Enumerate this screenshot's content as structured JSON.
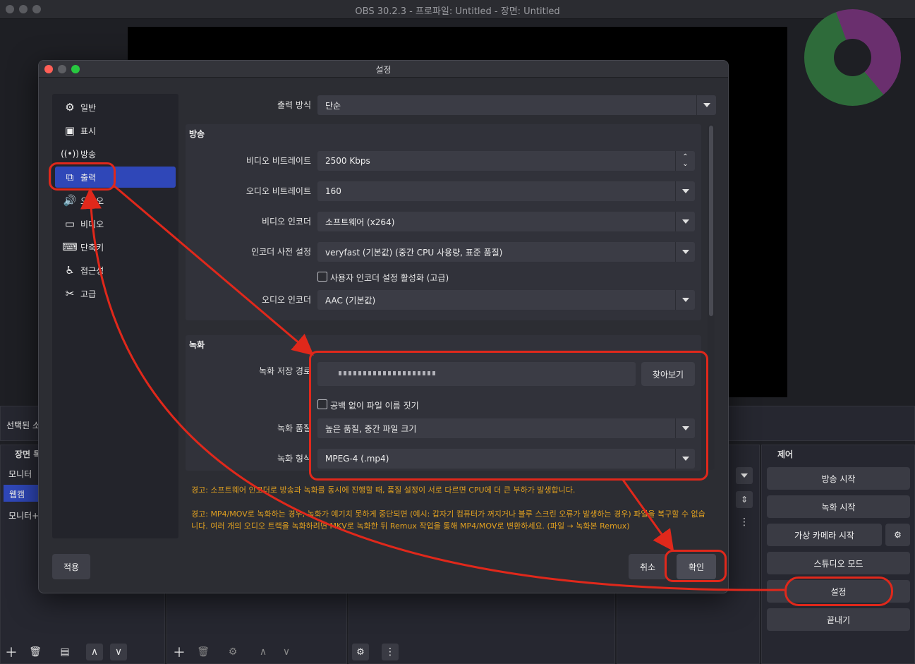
{
  "window": {
    "title": "OBS 30.2.3 - 프로파일: Untitled - 장면: Untitled"
  },
  "main": {
    "selected_source_text": "선택된 소",
    "scenes_header": "장면 목",
    "scenes": [
      "모니터",
      "웹캠",
      "모니터+"
    ],
    "controls_header": "제어",
    "controls": {
      "start_stream": "방송 시작",
      "start_record": "녹화 시작",
      "start_virtualcam": "가상 카메라 시작",
      "studio_mode": "스튜디오 모드",
      "settings": "설정",
      "exit": "끝내기"
    }
  },
  "dialog": {
    "title": "설정",
    "sidebar": [
      {
        "label": "일반",
        "icon": "gear-icon"
      },
      {
        "label": "표시",
        "icon": "display-icon"
      },
      {
        "label": "방송",
        "icon": "broadcast-icon"
      },
      {
        "label": "출력",
        "icon": "output-icon"
      },
      {
        "label": "오디오",
        "icon": "speaker-icon"
      },
      {
        "label": "비디오",
        "icon": "monitor-icon"
      },
      {
        "label": "단축키",
        "icon": "keyboard-icon"
      },
      {
        "label": "접근성",
        "icon": "accessibility-icon"
      },
      {
        "label": "고급",
        "icon": "wrench-icon"
      }
    ],
    "output_mode_label": "출력 방식",
    "output_mode_value": "단순",
    "streaming": {
      "title": "방송",
      "video_bitrate_label": "비디오 비트레이트",
      "video_bitrate_value": "2500 Kbps",
      "audio_bitrate_label": "오디오 비트레이트",
      "audio_bitrate_value": "160",
      "video_encoder_label": "비디오 인코더",
      "video_encoder_value": "소프트웨어 (x264)",
      "encoder_preset_label": "인코더 사전 설정",
      "encoder_preset_value": "veryfast (기본값) (중간 CPU 사용량, 표준 품질)",
      "custom_encoder_label": "사용자 인코더 설정 활성화 (고급)",
      "audio_encoder_label": "오디오 인코더",
      "audio_encoder_value": "AAC (기본값)"
    },
    "recording": {
      "title": "녹화",
      "path_label": "녹화 저장 경로",
      "path_value": "",
      "browse_label": "찾아보기",
      "no_space_label": "공백 없이 파일 이름 짓기",
      "quality_label": "녹화 품질",
      "quality_value": "높은 품질, 중간 파일 크기",
      "format_label": "녹화 형식",
      "format_value": "MPEG-4 (.mp4)"
    },
    "warning1": "경고: 소프트웨어 인코더로 방송과 녹화를 동시에 진행할 때, 품질 설정이 서로 다르면 CPU에 더 큰 부하가 발생합니다.",
    "warning2": "경고: MP4/MOV로 녹화하는 경우, 녹화가 예기치 못하게 중단되면 (예시: 갑자기 컴퓨터가 꺼지거나 블루 스크린 오류가 발생하는 경우) 파일을 복구할 수 없습니다. 여러 개의 오디오 트랙을 녹화하려면 MKV로 녹화한 뒤 Remux 작업을 통해 MP4/MOV로 변환하세요. (파일 → 녹화본 Remux)",
    "apply_label": "적용",
    "cancel_label": "취소",
    "ok_label": "확인"
  },
  "colors": {
    "accent": "#2f47b8",
    "annotation": "#e0281b",
    "warning": "#e0a020"
  }
}
